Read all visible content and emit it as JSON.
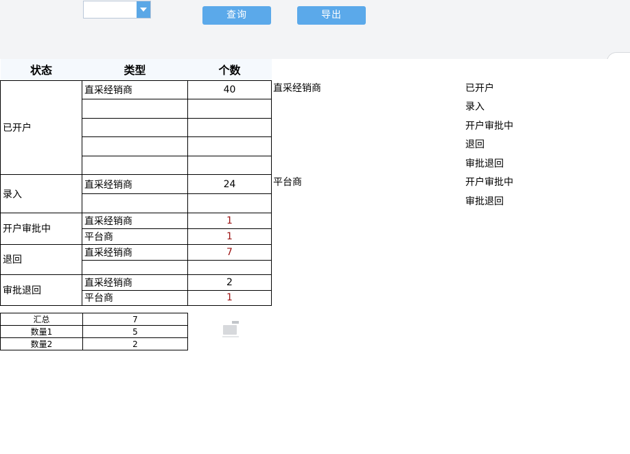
{
  "toolbar": {
    "select_value": "",
    "query_label": "查询",
    "export_label": "导出"
  },
  "table": {
    "headers": [
      "状态",
      "类型",
      "个数"
    ],
    "groups": [
      {
        "status": "已开户",
        "rows": [
          {
            "type": "直采经销商",
            "count": "40"
          },
          {
            "type": "",
            "count": ""
          },
          {
            "type": "",
            "count": ""
          },
          {
            "type": "",
            "count": ""
          },
          {
            "type": "",
            "count": ""
          }
        ]
      },
      {
        "status": "录入",
        "rows": [
          {
            "type": "直采经销商",
            "count": "24"
          },
          {
            "type": "",
            "count": ""
          }
        ]
      },
      {
        "status": "开户审批中",
        "rows": [
          {
            "type": "直采经销商",
            "count": "1"
          },
          {
            "type": "平台商",
            "count": "1"
          }
        ]
      },
      {
        "status": "退回",
        "rows": [
          {
            "type": "直采经销商",
            "count": "7"
          },
          {
            "type": "",
            "count": ""
          }
        ]
      },
      {
        "status": "审批退回",
        "rows": [
          {
            "type": "直采经销商",
            "count": "2"
          },
          {
            "type": "平台商",
            "count": "1"
          }
        ]
      }
    ]
  },
  "summary": [
    {
      "label": "汇总",
      "value": "7"
    },
    {
      "label": "数量1",
      "value": "5"
    },
    {
      "label": "数量2",
      "value": "2"
    }
  ],
  "side_types": [
    "直采经销商",
    "平台商"
  ],
  "side_statuses": [
    "已开户",
    "录入",
    "开户审批中",
    "退回",
    "审批退回",
    "开户审批中",
    "审批退回"
  ],
  "colors": {
    "button": "#5ba9ea",
    "toolbar_bg": "#f3f4f6",
    "count_red": "#9a1010"
  }
}
